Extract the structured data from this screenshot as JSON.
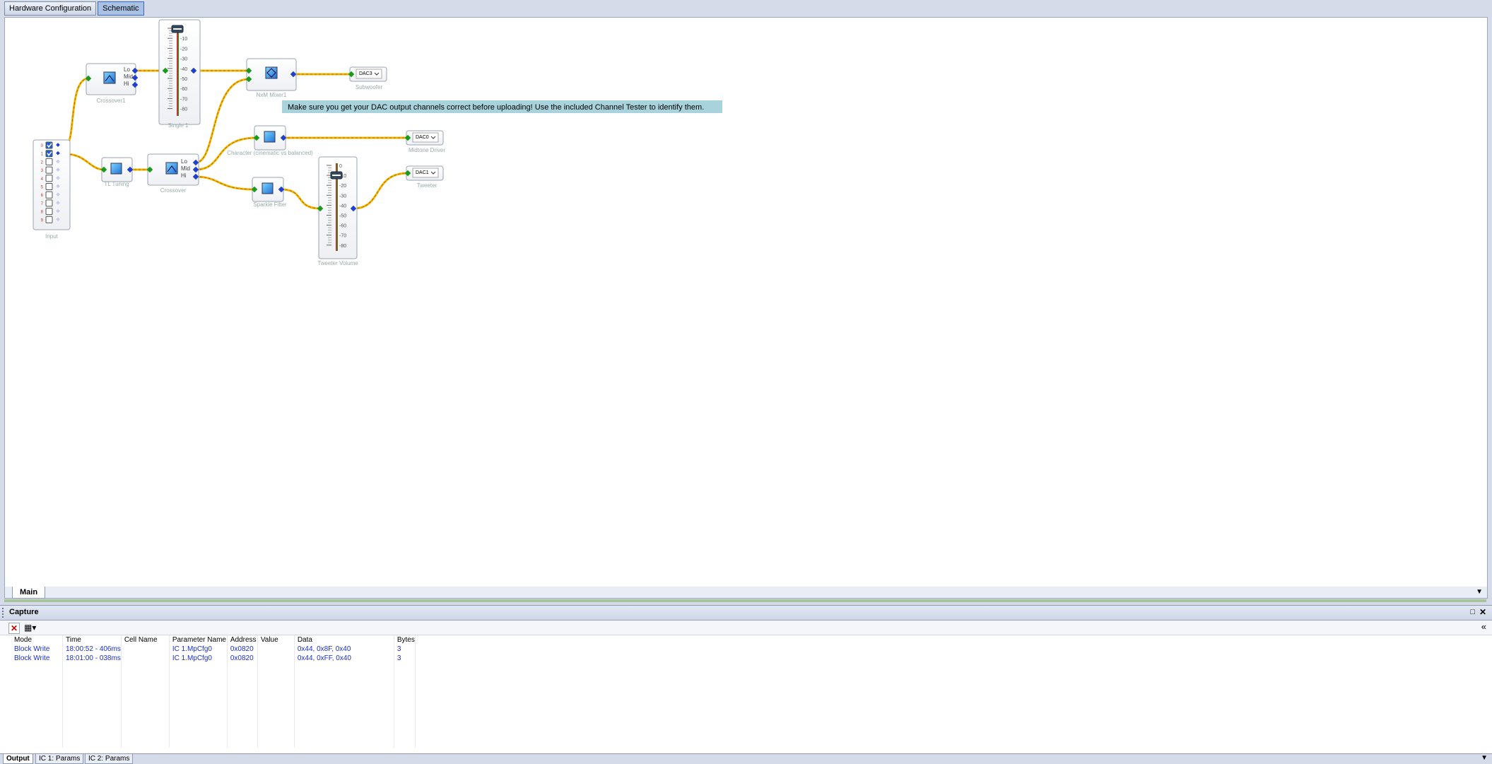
{
  "doc_tabs": [
    {
      "label": "Hardware Configuration"
    },
    {
      "label": "Schematic"
    }
  ],
  "schematic": {
    "blocks": {
      "input": "Input",
      "crossover1": "Crossover1",
      "single1": "Single 1",
      "nxm_mixer": "NxM Mixer1",
      "subwoofer": "Subwoofer",
      "tl_tuning": "TL Tuning",
      "crossover": "Crossover",
      "character": "Character (cinematic vs balanced)",
      "midtone": "Midtone Driver",
      "sparkle": "Sparkle Filter",
      "tweeter_volume": "Tweeter Volume",
      "tweeter": "Tweeter"
    },
    "crossover_ports": [
      "Lo",
      "Mid",
      "Hi"
    ],
    "input_channels": [
      "0",
      "1",
      "2",
      "3",
      "4",
      "5",
      "6",
      "7",
      "8",
      "9"
    ],
    "input_checked": [
      true,
      true,
      false,
      false,
      false,
      false,
      false,
      false,
      false,
      false
    ],
    "fader_scale": [
      "0",
      "-10",
      "-20",
      "-30",
      "-40",
      "-50",
      "-60",
      "-70",
      "-80"
    ],
    "dac_values": {
      "subwoofer": "DAC3",
      "midtone": "DAC0",
      "tweeter": "DAC1"
    },
    "note": "Make sure you get your DAC output channels correct before uploading! Use the included Channel Tester to identify them.",
    "colors": {
      "wire": "#f5b800",
      "wire_dash": "#c47d00",
      "port_in": "#1a9a1a",
      "port_out": "#1f3fd0",
      "note_bg": "#a9d3dc",
      "block_border": "#9aa3b0"
    }
  },
  "sheet_tabs": [
    {
      "label": "Main"
    }
  ],
  "capture": {
    "title": "Capture",
    "columns": [
      "Mode",
      "Time",
      "Cell Name",
      "Parameter Name",
      "Address",
      "Value",
      "Data",
      "Bytes"
    ],
    "rows": [
      [
        "Block Write",
        "18:00:52 - 406ms",
        "",
        "IC 1.MpCfg0",
        "0x0820",
        "",
        "0x44, 0x8F, 0x40",
        "3"
      ],
      [
        "Block Write",
        "18:01:00 - 038ms",
        "",
        "IC 1.MpCfg0",
        "0x0820",
        "",
        "0x44, 0xFF, 0x40",
        "3"
      ]
    ]
  },
  "output_tabs": [
    {
      "label": "Output"
    },
    {
      "label": "IC 1: Params"
    },
    {
      "label": "IC 2: Params"
    }
  ]
}
